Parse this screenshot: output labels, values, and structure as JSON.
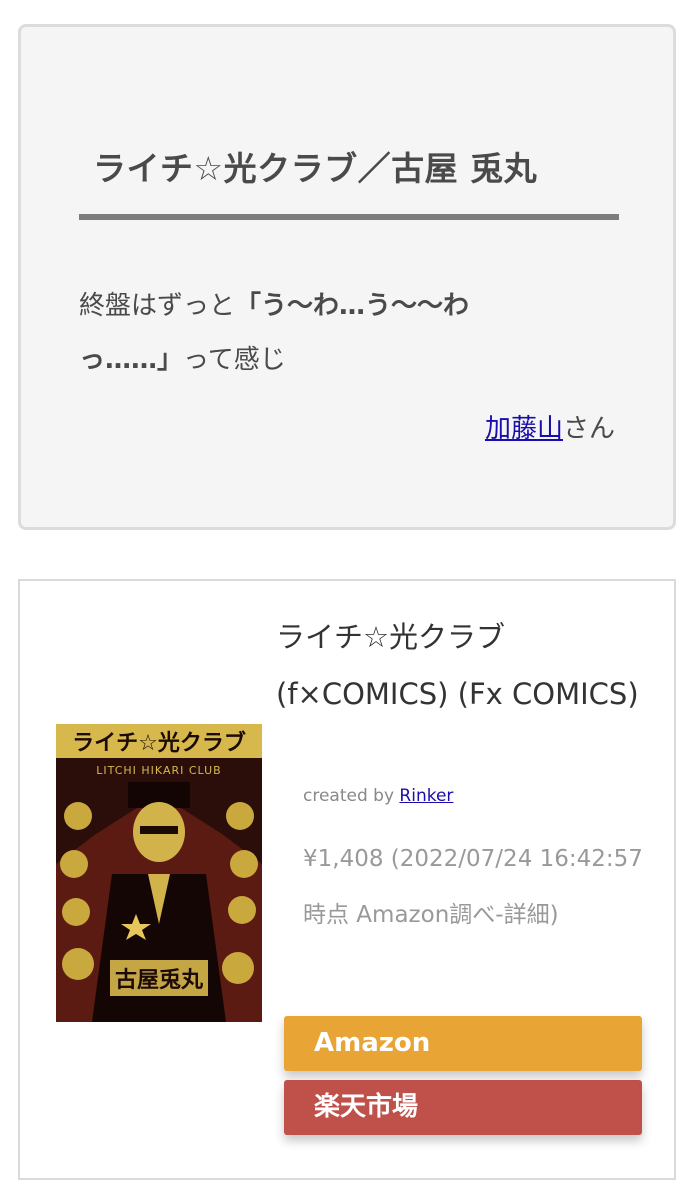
{
  "review": {
    "title": "ライチ☆光クラブ／古屋 兎丸",
    "body_prefix": "終盤はずっと",
    "body_quote": "「う〜わ…う〜〜わっ……」",
    "body_suffix": "って感じ",
    "author_name": "加藤山",
    "author_suffix": "さん"
  },
  "product": {
    "title": "ライチ☆光クラブ (f×COMICS) (Fx COMICS)",
    "credit_prefix": "created by",
    "credit_link": "Rinker",
    "price_info": "¥1,408 (2022/07/24 16:42:57時点 Amazon調べ-詳細)",
    "cover_title": "ライチ☆光クラブ",
    "cover_title_latin": "LITCHI HIKARI CLUB",
    "cover_author": "古屋兎丸",
    "buttons": {
      "amazon": "Amazon",
      "rakuten": "楽天市場"
    },
    "colors": {
      "amazon": "#e9a436",
      "rakuten": "#c0504a"
    }
  }
}
